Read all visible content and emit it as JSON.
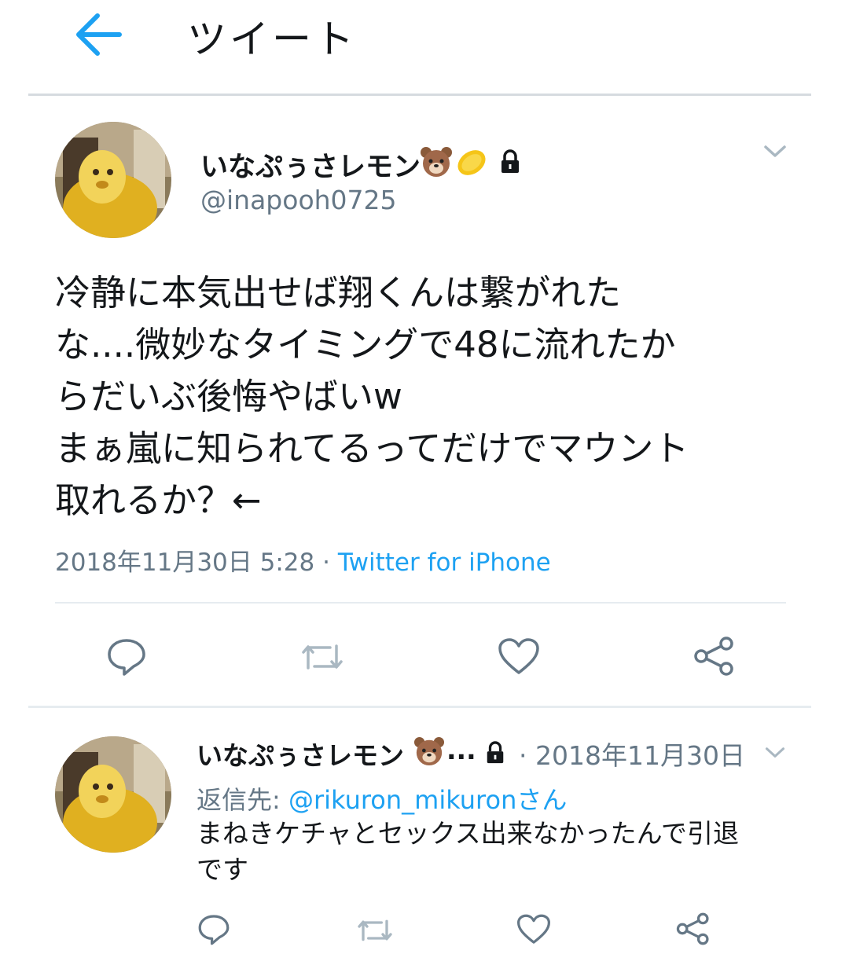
{
  "header": {
    "title": "ツイート"
  },
  "tweet": {
    "display_name": "いなぷぅさレモン",
    "name_emojis": [
      "bear-face-emoji",
      "lemon-emoji"
    ],
    "handle": "@inapooh0725",
    "text_lines": [
      "冷静に本気出せば翔くんは繋がれた",
      "な....微妙なタイミングで48に流れたか",
      "らだいぶ後悔やばいw",
      "まぁ嵐に知られてるってだけでマウント",
      "取れるか？←"
    ],
    "timestamp": "2018年11月30日 5:28",
    "separator": "·",
    "source": "Twitter for iPhone"
  },
  "reply": {
    "display_name": "いなぷぅさレモン",
    "ellipsis": "...",
    "date": "· 2018年11月30日",
    "reply_to_label": "返信先:",
    "reply_to_handle": "@rikuron_mikuron",
    "reply_to_suffix": "さん",
    "text_lines": [
      "まねきケチャとセックス出来なかったんで引退",
      "です"
    ]
  },
  "icons": [
    "back-arrow-icon",
    "chevron-down-icon",
    "lock-icon",
    "reply-icon",
    "retweet-icon",
    "like-icon",
    "share-icon"
  ],
  "colors": {
    "accent": "#1da1f2",
    "muted": "#657786",
    "text": "#14171a",
    "divider": "#e6ecf0"
  }
}
